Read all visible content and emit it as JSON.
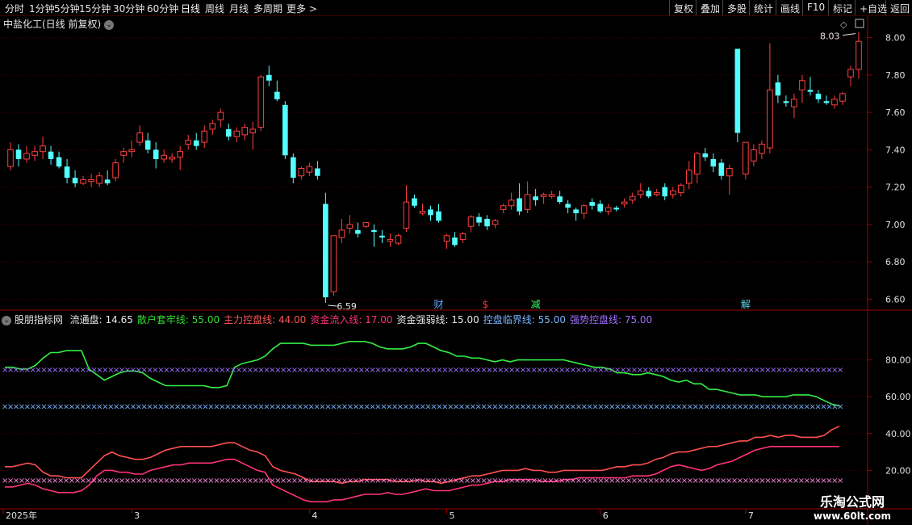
{
  "toolbar": {
    "periods": [
      "分时",
      "1分钟",
      "5分钟",
      "15分钟",
      "30分钟",
      "60分钟",
      "日线",
      "周线",
      "月线",
      "多周期",
      "更多 >"
    ],
    "active_period": "日线",
    "right_buttons": [
      "复权",
      "叠加",
      "多股",
      "统计",
      "画线",
      "F10",
      "标记",
      "+自选",
      "返回"
    ]
  },
  "main": {
    "title": "中盐化工(日线 前复权)",
    "high_label": "8.03",
    "low_label": "6.59",
    "events": [
      {
        "label": "财",
        "color": "#5aa8ff"
      },
      {
        "label": "$",
        "color": "#ff3030"
      },
      {
        "label": "减",
        "color": "#33ff66"
      },
      {
        "label": "解",
        "color": "#5fd6e8"
      }
    ]
  },
  "indicator_header": {
    "name": "股朋指标网",
    "items": [
      {
        "label": "流通盘: 14.65",
        "color": "#e6e6e6"
      },
      {
        "label": "散户套牢线: 55.00",
        "color": "#33dd33"
      },
      {
        "label": "主力控盘线: 44.00",
        "color": "#ff5555"
      },
      {
        "label": "资金流入线: 17.00",
        "color": "#ff3377"
      },
      {
        "label": "资金强弱线: 15.00",
        "color": "#e6e6e6"
      },
      {
        "label": "控盘临界线: 55.00",
        "color": "#7ab4ff"
      },
      {
        "label": "强势控盘线: 75.00",
        "color": "#a070ff"
      }
    ]
  },
  "date_axis": [
    "2025年",
    "3",
    "4",
    "5",
    "6",
    "7"
  ],
  "watermark": {
    "title": "乐淘公式网",
    "url": "www.60lt.com"
  },
  "colors": {
    "up": "#ff4040",
    "down": "#54ffff",
    "grid": "#5a0000",
    "axis": "#a00000",
    "tick_text": "#e0e0e0"
  },
  "chart_data": [
    {
      "type": "candlestick",
      "title": "中盐化工(日线 前复权)",
      "y_ticks": [
        8.0,
        7.8,
        7.6,
        7.4,
        7.2,
        7.0,
        6.8,
        6.6
      ],
      "ylim": [
        6.55,
        8.05
      ],
      "grid": true,
      "ohlc": [
        [
          7.31,
          7.44,
          7.29,
          7.4
        ],
        [
          7.4,
          7.43,
          7.31,
          7.35
        ],
        [
          7.35,
          7.42,
          7.33,
          7.38
        ],
        [
          7.37,
          7.42,
          7.34,
          7.39
        ],
        [
          7.39,
          7.47,
          7.35,
          7.42
        ],
        [
          7.39,
          7.42,
          7.32,
          7.35
        ],
        [
          7.36,
          7.39,
          7.3,
          7.31
        ],
        [
          7.31,
          7.35,
          7.22,
          7.25
        ],
        [
          7.25,
          7.29,
          7.2,
          7.22
        ],
        [
          7.22,
          7.26,
          7.21,
          7.24
        ],
        [
          7.23,
          7.27,
          7.2,
          7.24
        ],
        [
          7.22,
          7.28,
          7.2,
          7.26
        ],
        [
          7.24,
          7.29,
          7.21,
          7.22
        ],
        [
          7.25,
          7.35,
          7.23,
          7.33
        ],
        [
          7.37,
          7.41,
          7.33,
          7.39
        ],
        [
          7.39,
          7.45,
          7.36,
          7.4
        ],
        [
          7.44,
          7.53,
          7.42,
          7.49
        ],
        [
          7.45,
          7.49,
          7.38,
          7.4
        ],
        [
          7.4,
          7.44,
          7.3,
          7.35
        ],
        [
          7.35,
          7.4,
          7.33,
          7.37
        ],
        [
          7.35,
          7.38,
          7.33,
          7.36
        ],
        [
          7.36,
          7.42,
          7.29,
          7.39
        ],
        [
          7.43,
          7.48,
          7.4,
          7.45
        ],
        [
          7.45,
          7.49,
          7.4,
          7.42
        ],
        [
          7.44,
          7.53,
          7.41,
          7.5
        ],
        [
          7.51,
          7.56,
          7.48,
          7.54
        ],
        [
          7.56,
          7.62,
          7.52,
          7.6
        ],
        [
          7.51,
          7.54,
          7.45,
          7.47
        ],
        [
          7.47,
          7.52,
          7.44,
          7.5
        ],
        [
          7.48,
          7.54,
          7.45,
          7.52
        ],
        [
          7.49,
          7.55,
          7.4,
          7.51
        ],
        [
          7.52,
          7.8,
          7.5,
          7.79
        ],
        [
          7.8,
          7.85,
          7.74,
          7.77
        ],
        [
          7.71,
          7.77,
          7.66,
          7.67
        ],
        [
          7.64,
          7.66,
          7.35,
          7.37
        ],
        [
          7.36,
          7.38,
          7.22,
          7.25
        ],
        [
          7.26,
          7.31,
          7.24,
          7.3
        ],
        [
          7.28,
          7.33,
          7.26,
          7.31
        ],
        [
          7.3,
          7.34,
          7.24,
          7.26
        ],
        [
          7.11,
          7.17,
          6.58,
          6.61
        ],
        [
          6.64,
          6.93,
          6.62,
          6.94
        ],
        [
          6.93,
          7.03,
          6.9,
          6.97
        ],
        [
          6.98,
          7.05,
          6.95,
          7.0
        ],
        [
          6.97,
          7.01,
          6.93,
          6.95
        ],
        [
          6.99,
          7.01,
          6.98,
          7.01
        ],
        [
          6.97,
          7.0,
          6.88,
          6.96
        ],
        [
          6.94,
          6.97,
          6.9,
          6.93
        ],
        [
          6.91,
          6.95,
          6.88,
          6.92
        ],
        [
          6.9,
          6.95,
          6.89,
          6.94
        ],
        [
          6.98,
          7.21,
          6.96,
          7.12
        ],
        [
          7.14,
          7.16,
          7.09,
          7.1
        ],
        [
          7.06,
          7.11,
          7.05,
          7.07
        ],
        [
          7.08,
          7.1,
          7.02,
          7.05
        ],
        [
          7.07,
          7.11,
          7.01,
          7.02
        ],
        [
          6.91,
          6.95,
          6.87,
          6.94
        ],
        [
          6.93,
          6.96,
          6.88,
          6.89
        ],
        [
          6.92,
          6.96,
          6.9,
          6.95
        ],
        [
          6.99,
          7.05,
          6.96,
          7.04
        ],
        [
          7.04,
          7.06,
          6.99,
          7.01
        ],
        [
          7.03,
          7.05,
          6.97,
          6.99
        ],
        [
          7.0,
          7.03,
          6.98,
          7.02
        ],
        [
          7.08,
          7.11,
          7.06,
          7.1
        ],
        [
          7.1,
          7.17,
          7.08,
          7.13
        ],
        [
          7.14,
          7.22,
          7.05,
          7.07
        ],
        [
          7.08,
          7.23,
          7.06,
          7.16
        ],
        [
          7.15,
          7.19,
          7.1,
          7.13
        ],
        [
          7.15,
          7.17,
          7.11,
          7.16
        ],
        [
          7.15,
          7.18,
          7.14,
          7.16
        ],
        [
          7.15,
          7.18,
          7.11,
          7.12
        ],
        [
          7.11,
          7.13,
          7.06,
          7.09
        ],
        [
          7.08,
          7.09,
          7.02,
          7.06
        ],
        [
          7.06,
          7.11,
          7.03,
          7.1
        ],
        [
          7.12,
          7.14,
          7.08,
          7.1
        ],
        [
          7.11,
          7.13,
          7.06,
          7.07
        ],
        [
          7.07,
          7.11,
          7.05,
          7.09
        ],
        [
          7.09,
          7.1,
          7.07,
          7.08
        ],
        [
          7.11,
          7.14,
          7.09,
          7.12
        ],
        [
          7.13,
          7.17,
          7.11,
          7.15
        ],
        [
          7.16,
          7.22,
          7.14,
          7.18
        ],
        [
          7.18,
          7.2,
          7.14,
          7.15
        ],
        [
          7.16,
          7.19,
          7.15,
          7.17
        ],
        [
          7.2,
          7.22,
          7.13,
          7.15
        ],
        [
          7.16,
          7.2,
          7.14,
          7.18
        ],
        [
          7.17,
          7.22,
          7.15,
          7.21
        ],
        [
          7.22,
          7.34,
          7.19,
          7.29
        ],
        [
          7.27,
          7.39,
          7.22,
          7.38
        ],
        [
          7.38,
          7.41,
          7.34,
          7.36
        ],
        [
          7.35,
          7.38,
          7.28,
          7.31
        ],
        [
          7.33,
          7.35,
          7.24,
          7.26
        ],
        [
          7.26,
          7.32,
          7.16,
          7.3
        ],
        [
          7.94,
          7.94,
          7.44,
          7.49
        ],
        [
          7.27,
          7.44,
          7.24,
          7.44
        ],
        [
          7.34,
          7.43,
          7.31,
          7.4
        ],
        [
          7.38,
          7.45,
          7.35,
          7.43
        ],
        [
          7.41,
          7.97,
          7.38,
          7.72
        ],
        [
          7.76,
          7.8,
          7.65,
          7.69
        ],
        [
          7.66,
          7.69,
          7.63,
          7.65
        ],
        [
          7.63,
          7.7,
          7.57,
          7.67
        ],
        [
          7.72,
          7.8,
          7.65,
          7.77
        ],
        [
          7.72,
          7.79,
          7.69,
          7.71
        ],
        [
          7.7,
          7.72,
          7.65,
          7.67
        ],
        [
          7.66,
          7.69,
          7.64,
          7.65
        ],
        [
          7.64,
          7.69,
          7.62,
          7.67
        ],
        [
          7.66,
          7.71,
          7.64,
          7.7
        ],
        [
          7.79,
          7.85,
          7.74,
          7.83
        ],
        [
          7.83,
          8.03,
          7.78,
          7.98
        ]
      ]
    },
    {
      "type": "line",
      "ylim": [
        0,
        100
      ],
      "y_ticks": [
        80,
        60,
        40,
        20
      ],
      "series": [
        {
          "name": "散户套牢线",
          "color": "#33ee44",
          "values": [
            76,
            76,
            75,
            75,
            77,
            81,
            84,
            84,
            85,
            85,
            85,
            75,
            72,
            69,
            71,
            73,
            74,
            74,
            73,
            70,
            68,
            66,
            66,
            66,
            66,
            66,
            66,
            65,
            65,
            66,
            76,
            78,
            79,
            80,
            82,
            86,
            89,
            89,
            89,
            89,
            88,
            88,
            88,
            88,
            89,
            90,
            90,
            90,
            89,
            87,
            86,
            86,
            86,
            87,
            89,
            89,
            87,
            85,
            84,
            82,
            82,
            81,
            81,
            80,
            79,
            80,
            79,
            80,
            80,
            80,
            80,
            80,
            80,
            80,
            79,
            78,
            77,
            76,
            76,
            75,
            73,
            73,
            72,
            72,
            73,
            72,
            71,
            69,
            68,
            69,
            67,
            67,
            64,
            64,
            63,
            62,
            61,
            61,
            61,
            60,
            60,
            60,
            60,
            61,
            61,
            61,
            60,
            58,
            56,
            55
          ]
        },
        {
          "name": "主力控盘线",
          "color": "#ff5050",
          "values": [
            22,
            22,
            23,
            24,
            23,
            19,
            17,
            17,
            16,
            16,
            16,
            20,
            24,
            28,
            30,
            28,
            27,
            26,
            26,
            27,
            29,
            31,
            32,
            33,
            33,
            33,
            33,
            33,
            34,
            35,
            35,
            33,
            31,
            30,
            28,
            22,
            20,
            19,
            18,
            16,
            14,
            14,
            14,
            14,
            13,
            14,
            14,
            15,
            15,
            15,
            15,
            14,
            14,
            14,
            15,
            14,
            14,
            13,
            14,
            15,
            16,
            17,
            17,
            18,
            19,
            20,
            20,
            20,
            21,
            20,
            20,
            19,
            19,
            20,
            20,
            20,
            20,
            20,
            20,
            21,
            22,
            22,
            23,
            23,
            24,
            26,
            27,
            29,
            30,
            30,
            31,
            32,
            33,
            33,
            34,
            35,
            36,
            36,
            38,
            38,
            39,
            38,
            39,
            39,
            38,
            38,
            38,
            39,
            42,
            44
          ]
        },
        {
          "name": "资金流入线",
          "color": "#ff3377",
          "values": [
            11,
            11,
            12,
            13,
            12,
            10,
            9,
            8,
            8,
            8,
            9,
            12,
            17,
            20,
            20,
            19,
            19,
            18,
            18,
            20,
            21,
            22,
            23,
            23,
            24,
            24,
            24,
            24,
            25,
            26,
            26,
            24,
            22,
            20,
            19,
            12,
            10,
            8,
            6,
            4,
            3,
            3,
            3,
            4,
            4,
            5,
            6,
            7,
            7,
            7,
            8,
            7,
            7,
            8,
            9,
            10,
            9,
            9,
            9,
            10,
            11,
            12,
            12,
            13,
            14,
            14,
            15,
            15,
            15,
            15,
            14,
            14,
            14,
            15,
            15,
            16,
            16,
            16,
            16,
            16,
            16,
            16,
            17,
            17,
            17,
            18,
            20,
            22,
            23,
            22,
            21,
            20,
            21,
            23,
            24,
            25,
            27,
            29,
            31,
            32,
            33,
            33,
            33,
            33,
            33,
            33,
            33,
            33,
            33,
            33
          ]
        },
        {
          "name": "控盘临界线",
          "color": "#7ab4ff",
          "marker": "x",
          "constant": 55
        },
        {
          "name": "强势控盘线",
          "color": "#a070ff",
          "marker": "x",
          "constant": 75
        },
        {
          "name": "资金强弱线",
          "color": "#ff88dd",
          "marker": "x",
          "constant": 15
        }
      ]
    }
  ]
}
